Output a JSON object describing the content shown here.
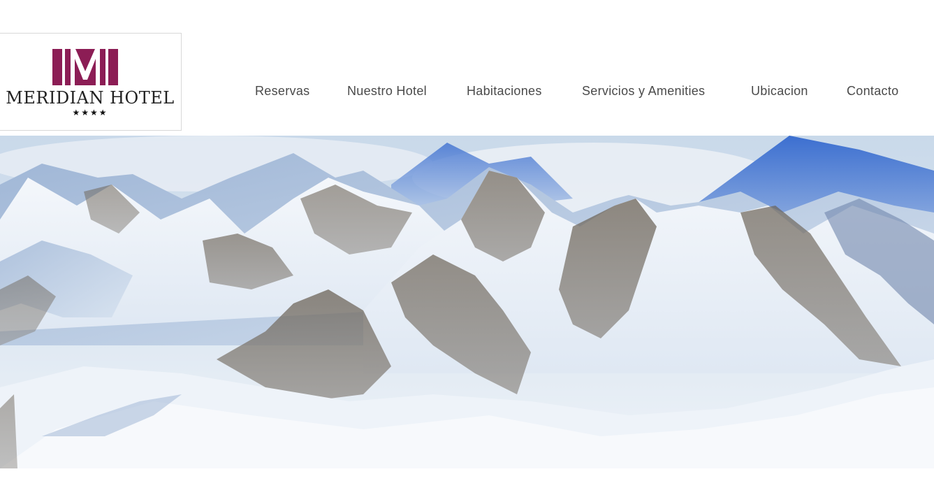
{
  "logo": {
    "name": "MERIDIAN HOTEL",
    "stars": "★★★★",
    "brand_color": "#8c1d55"
  },
  "nav": {
    "items": [
      {
        "label": "Reservas"
      },
      {
        "label": "Nuestro Hotel"
      },
      {
        "label": "Habitaciones"
      },
      {
        "label": "Servicios y Amenities"
      },
      {
        "label": "Ubicacion"
      },
      {
        "label": "Contacto"
      }
    ]
  },
  "hero": {
    "image_icon": "mountain-landscape-icon"
  }
}
